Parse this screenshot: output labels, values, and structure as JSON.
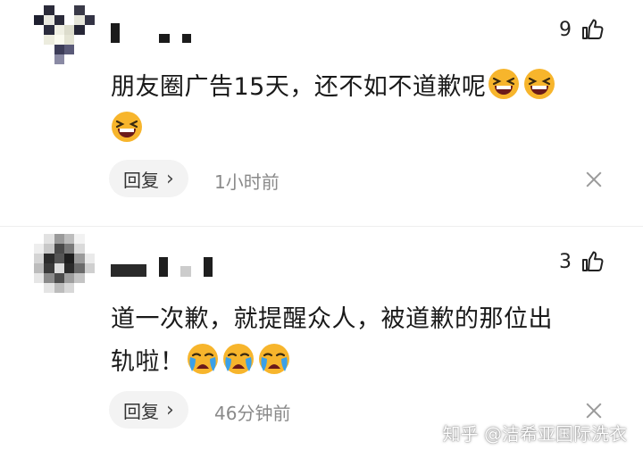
{
  "comments": [
    {
      "likes": "9",
      "text_lines": [
        "朋友圈广告15天，还不如不道歉呢"
      ],
      "emoji": "laughing-face",
      "reply_label": "回复",
      "time": "1小时前"
    },
    {
      "likes": "3",
      "text_lines": [
        "道一次歉，就提醒众人，被道歉的那位出",
        "轨啦！"
      ],
      "emoji": "crying-face",
      "reply_label": "回复",
      "time": "46分钟前"
    }
  ],
  "reply_chevron": "›",
  "watermark": "知乎 @洁希亚国际洗衣",
  "colors": {
    "text": "#191919",
    "meta": "#8a8a8a",
    "reply_bg": "#f3f3f3",
    "emoji_yellow": "#f7b52c",
    "emoji_tear": "#3aa0e8"
  }
}
